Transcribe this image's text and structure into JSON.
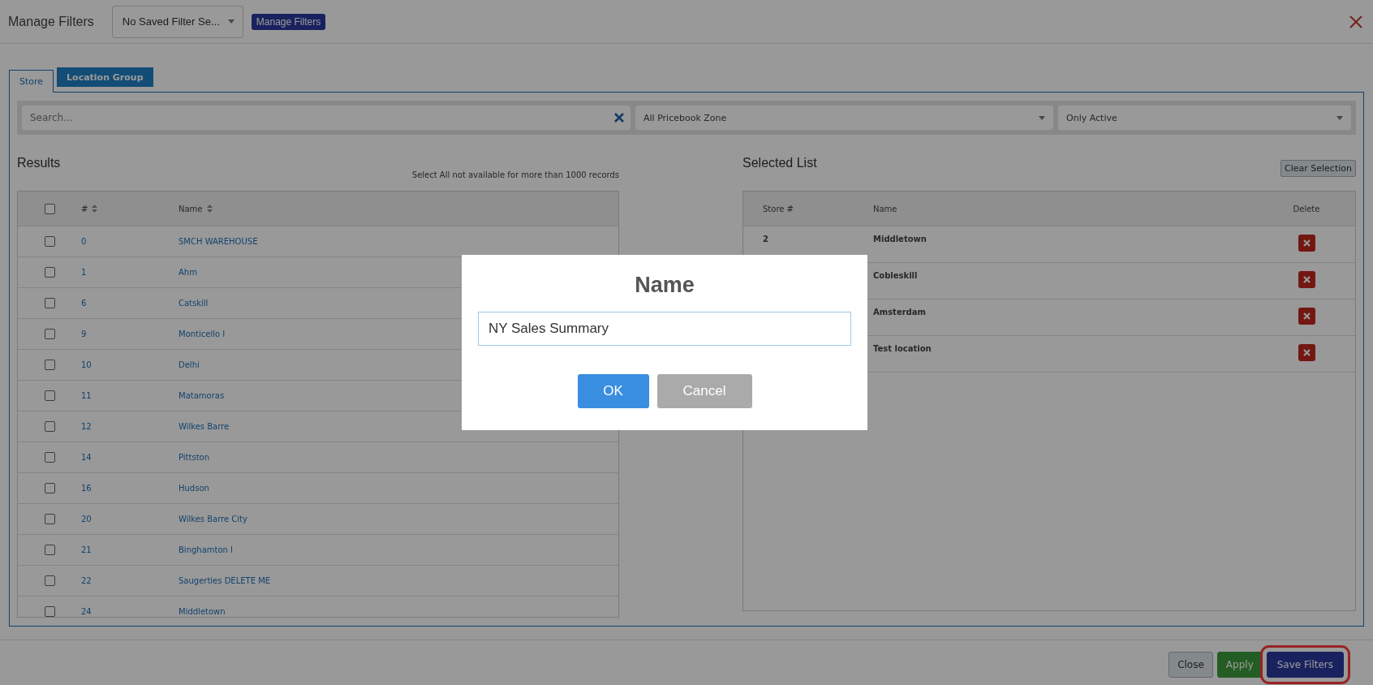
{
  "header": {
    "title": "Manage Filters",
    "saved_filter_select": "No Saved Filter Se...",
    "manage_button": "Manage Filters"
  },
  "tabs": [
    {
      "label": "Store",
      "selected": true
    },
    {
      "label": "Location Group",
      "selected": false
    }
  ],
  "search": {
    "placeholder": "Search...",
    "zone_select": "All Pricebook Zone",
    "status_select": "Only Active"
  },
  "results": {
    "title": "Results",
    "note": "Select All not available for more than 1000 records",
    "select_all_checked": false,
    "columns": [
      "#",
      "Name"
    ],
    "rows": [
      {
        "number": "0",
        "name": "SMCH WAREHOUSE",
        "checked": false
      },
      {
        "number": "1",
        "name": "Ahm",
        "checked": false
      },
      {
        "number": "6",
        "name": "Catskill",
        "checked": false
      },
      {
        "number": "9",
        "name": "Monticello I",
        "checked": false
      },
      {
        "number": "10",
        "name": "Delhi",
        "checked": false
      },
      {
        "number": "11",
        "name": "Matamoras",
        "checked": false
      },
      {
        "number": "12",
        "name": "Wilkes Barre",
        "checked": false
      },
      {
        "number": "14",
        "name": "Pittston",
        "checked": false
      },
      {
        "number": "16",
        "name": "Hudson",
        "checked": false
      },
      {
        "number": "20",
        "name": "Wilkes Barre City",
        "checked": false
      },
      {
        "number": "21",
        "name": "Binghamton I",
        "checked": false
      },
      {
        "number": "22",
        "name": "Saugerties DELETE ME",
        "checked": false
      },
      {
        "number": "24",
        "name": "Middletown",
        "checked": false
      }
    ]
  },
  "selected_list": {
    "title": "Selected List",
    "clear_button": "Clear Selection",
    "columns": [
      "Store #",
      "Name",
      "Delete"
    ],
    "rows": [
      {
        "store": "2",
        "name": "Middletown"
      },
      {
        "name": "Cobleskill"
      },
      {
        "name": "Amsterdam"
      },
      {
        "name": "Test location"
      }
    ]
  },
  "dialog": {
    "title": "Name",
    "value": "NY Sales Summary",
    "ok_button": "OK",
    "cancel_button": "Cancel"
  },
  "footer": {
    "buttons": [
      {
        "label": "Close",
        "kind": "default",
        "highlighted": false
      },
      {
        "label": "Apply",
        "kind": "success",
        "highlighted": false
      },
      {
        "label": "Save Filters",
        "kind": "primary",
        "highlighted": true
      }
    ]
  }
}
